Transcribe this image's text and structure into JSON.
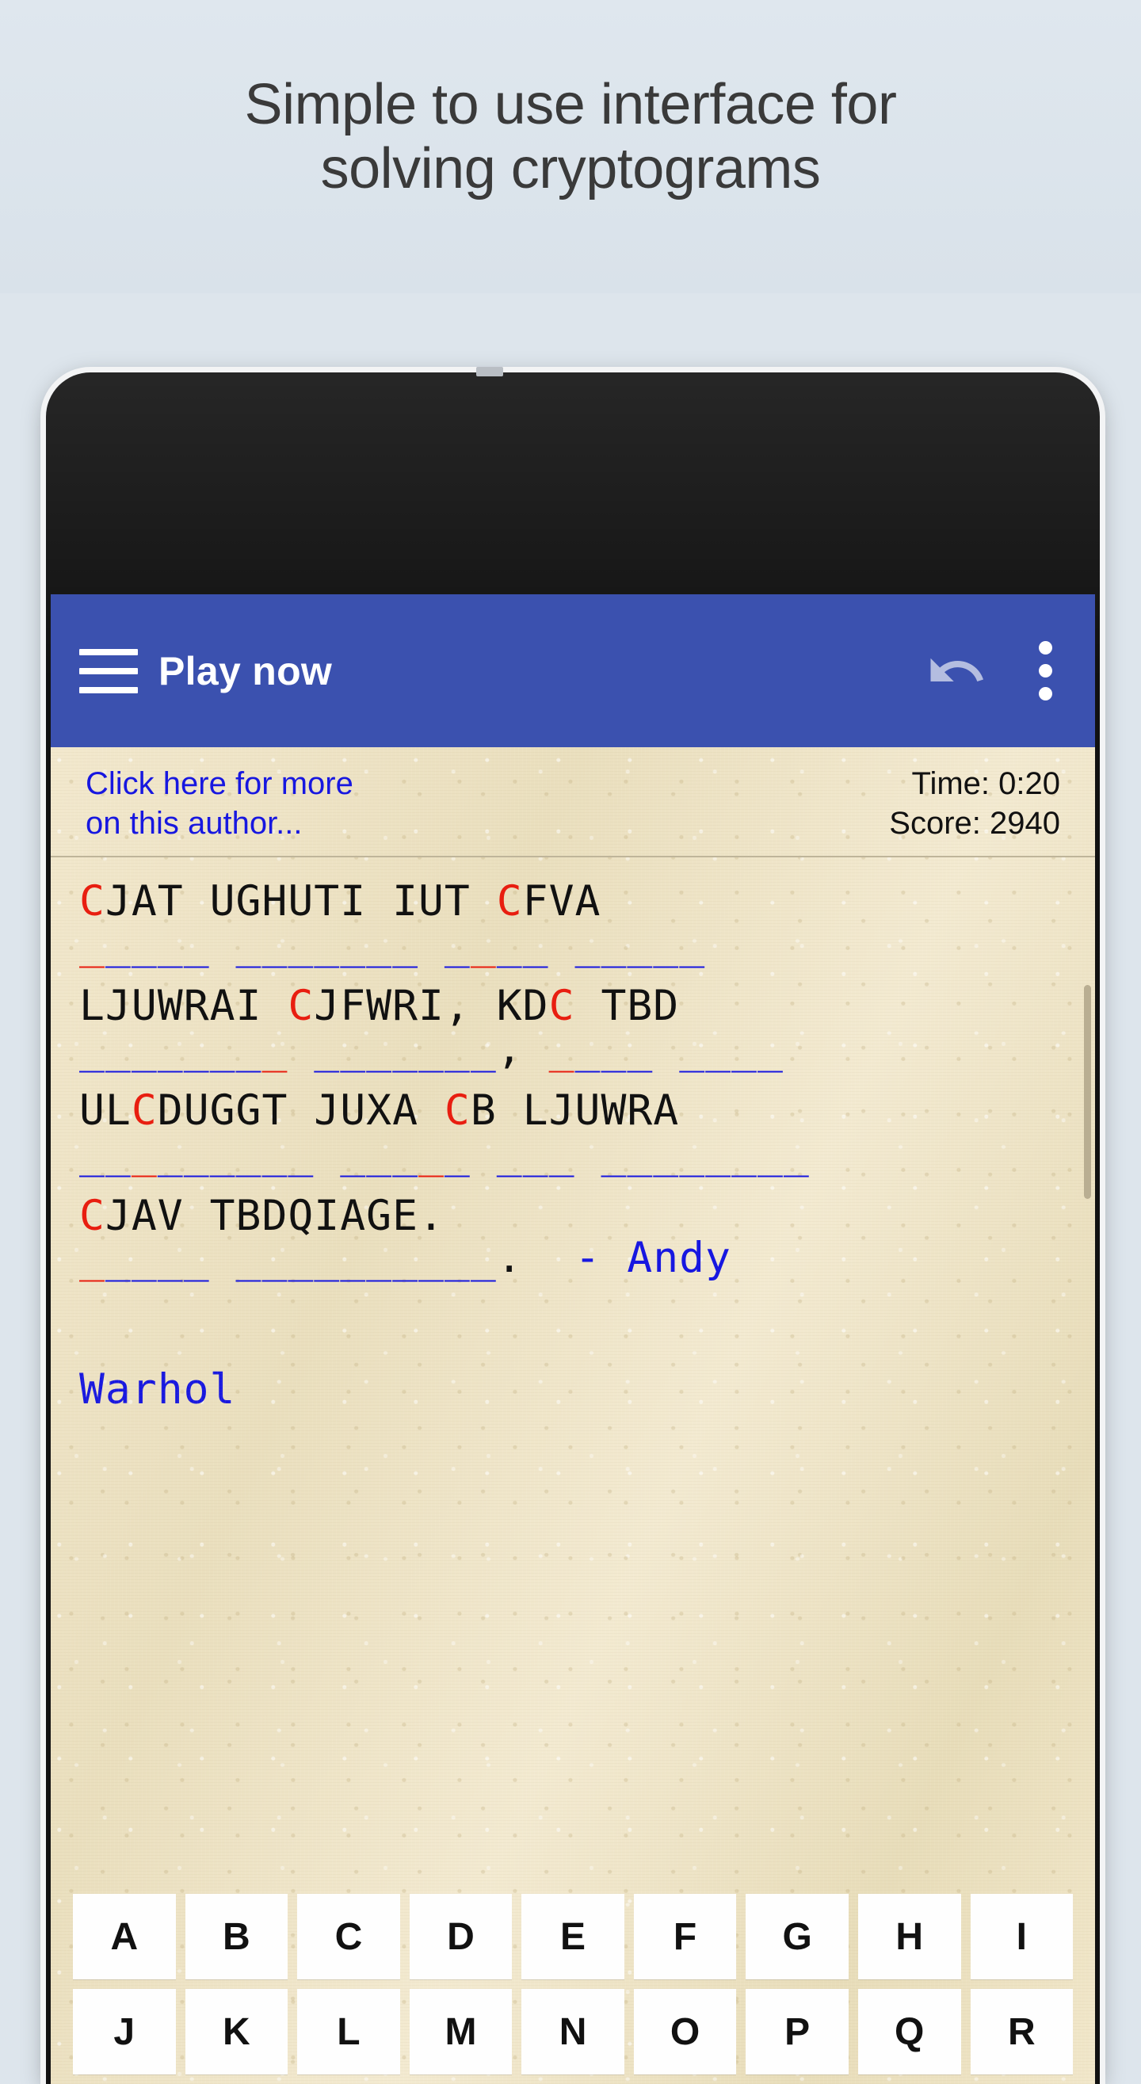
{
  "promo": {
    "line1": "Simple to use interface for",
    "line2": "solving cryptograms"
  },
  "colors": {
    "appbar": "#3B51AF",
    "link": "#1717E0",
    "selected_letter": "#E81E10",
    "paper": "#EEE3C6"
  },
  "appbar": {
    "title": "Play now",
    "menu_icon": "hamburger-icon",
    "undo_icon": "undo-icon",
    "overflow_icon": "more-vert-icon"
  },
  "info": {
    "author_link_line1": "Click here for more",
    "author_link_line2": "on this author...",
    "time_label": "Time: 0:20",
    "score_label": "Score: 2940"
  },
  "puzzle": {
    "selected_cipher_letter": "C",
    "lines": [
      {
        "cipher": "CJAT UGHUTI IUT CFVA",
        "blanks": "_____ _______ ____ _____"
      },
      {
        "cipher": "LJUWRAI CJFWRI, KDC TBD",
        "blanks": "________ _______, ____ ____"
      },
      {
        "cipher": "ULCDUGGT JUXA CB LJUWRA",
        "blanks": "_________ _____ ___ ________"
      },
      {
        "cipher": "CJAV TBDQIAGE.",
        "blanks": "_____ __________."
      }
    ],
    "attribution": "- Andy",
    "attribution_cont": "Warhol"
  },
  "keyboard": {
    "row1": [
      "A",
      "B",
      "C",
      "D",
      "E",
      "F",
      "G",
      "H",
      "I"
    ],
    "row2": [
      "J",
      "K",
      "L",
      "M",
      "N",
      "O",
      "P",
      "Q",
      "R"
    ]
  }
}
